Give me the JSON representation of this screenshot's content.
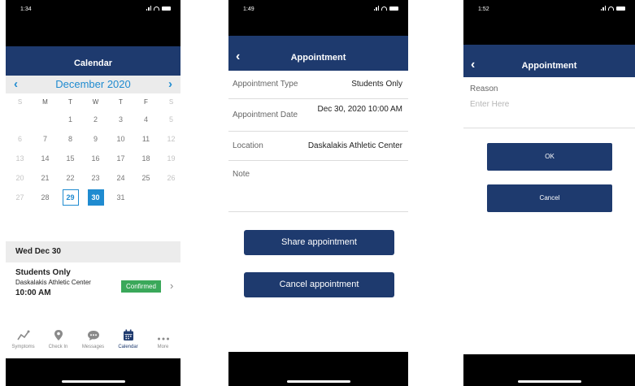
{
  "screen1": {
    "time": "1:34",
    "title": "Calendar",
    "month": "December 2020",
    "weekdays": [
      "S",
      "M",
      "T",
      "W",
      "T",
      "F",
      "S"
    ],
    "days": [
      "",
      "",
      "1",
      "2",
      "3",
      "4",
      "5",
      "6",
      "7",
      "8",
      "9",
      "10",
      "11",
      "12",
      "13",
      "14",
      "15",
      "16",
      "17",
      "18",
      "19",
      "20",
      "21",
      "22",
      "23",
      "24",
      "25",
      "26",
      "27",
      "28",
      "29",
      "30",
      "31",
      "",
      ""
    ],
    "date_header": "Wed Dec 30",
    "event": {
      "title": "Students Only",
      "location": "Daskalakis Athletic Center",
      "time": "10:00 AM",
      "status": "Confirmed"
    },
    "tabs": [
      "Symptoms",
      "Check In",
      "Messages",
      "Calendar",
      "More"
    ]
  },
  "screen2": {
    "time": "1:49",
    "title": "Appointment",
    "rows": [
      {
        "label": "Appointment Type",
        "value": "Students Only"
      },
      {
        "label": "Appointment Date",
        "value": "Dec 30, 2020 10:00 AM"
      },
      {
        "label": "Location",
        "value": "Daskalakis Athletic Center"
      },
      {
        "label": "Note",
        "value": ""
      }
    ],
    "share_label": "Share appointment",
    "cancel_label": "Cancel appointment"
  },
  "screen3": {
    "time": "1:52",
    "title": "Appointment",
    "reason_label": "Reason",
    "reason_placeholder": "Enter Here",
    "ok_label": "OK",
    "cancel_label": "Cancel"
  },
  "colors": {
    "navy": "#1e3a6e",
    "accent_blue": "#1f8bd0",
    "confirmed_green": "#3aa85a"
  }
}
